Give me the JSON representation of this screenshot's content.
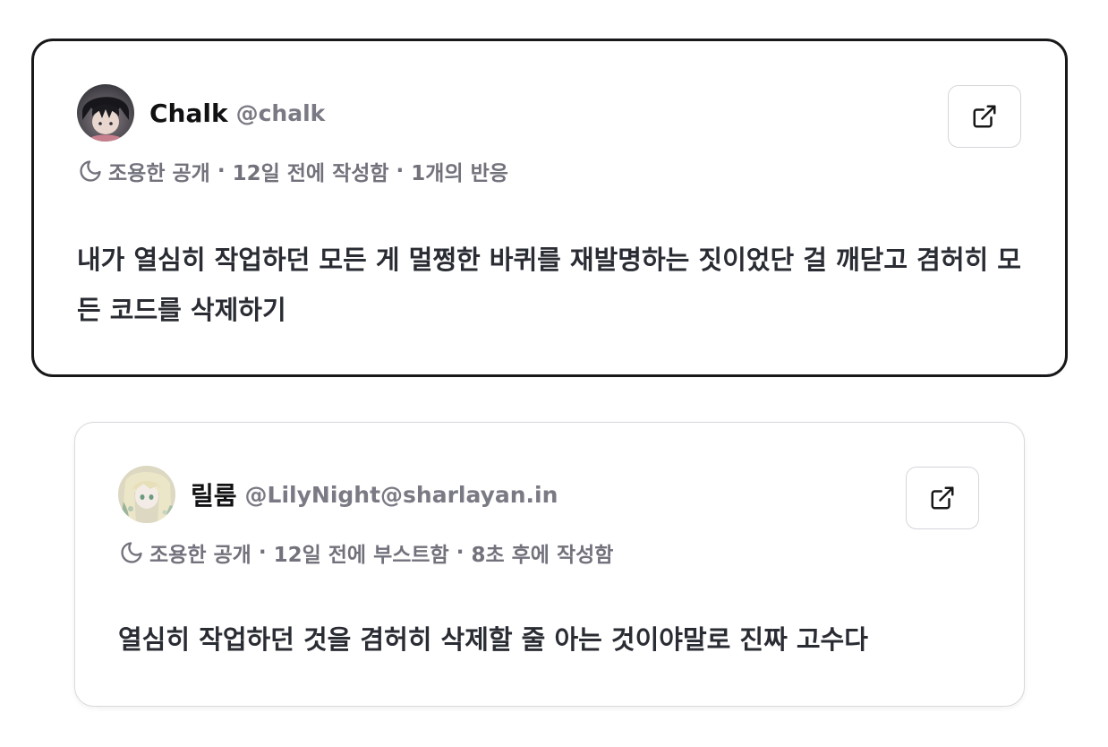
{
  "posts": [
    {
      "author": {
        "display_name": "Chalk",
        "handle": "@chalk"
      },
      "meta": {
        "visibility_icon": "moon-icon",
        "visibility": "조용한 공개",
        "time": "12일 전에 작성함",
        "reactions": "1개의 반응"
      },
      "content": "내가 열심히 작업하던 모든 게 멀쩡한 바퀴를 재발명하는 짓이었단 걸 깨닫고 겸허히 모든 코드를 삭제하기",
      "open_icon": "external-link-icon"
    },
    {
      "author": {
        "display_name": "릴룸",
        "handle": "@LilyNight@sharlayan.in"
      },
      "meta": {
        "visibility_icon": "moon-icon",
        "visibility": "조용한 공개",
        "boosted": "12일 전에 부스트함",
        "time": "8초 후에 작성함"
      },
      "content": "열심히 작업하던 것을 겸허히 삭제할 줄 아는 것이야말로 진짜 고수다",
      "open_icon": "external-link-icon"
    }
  ]
}
